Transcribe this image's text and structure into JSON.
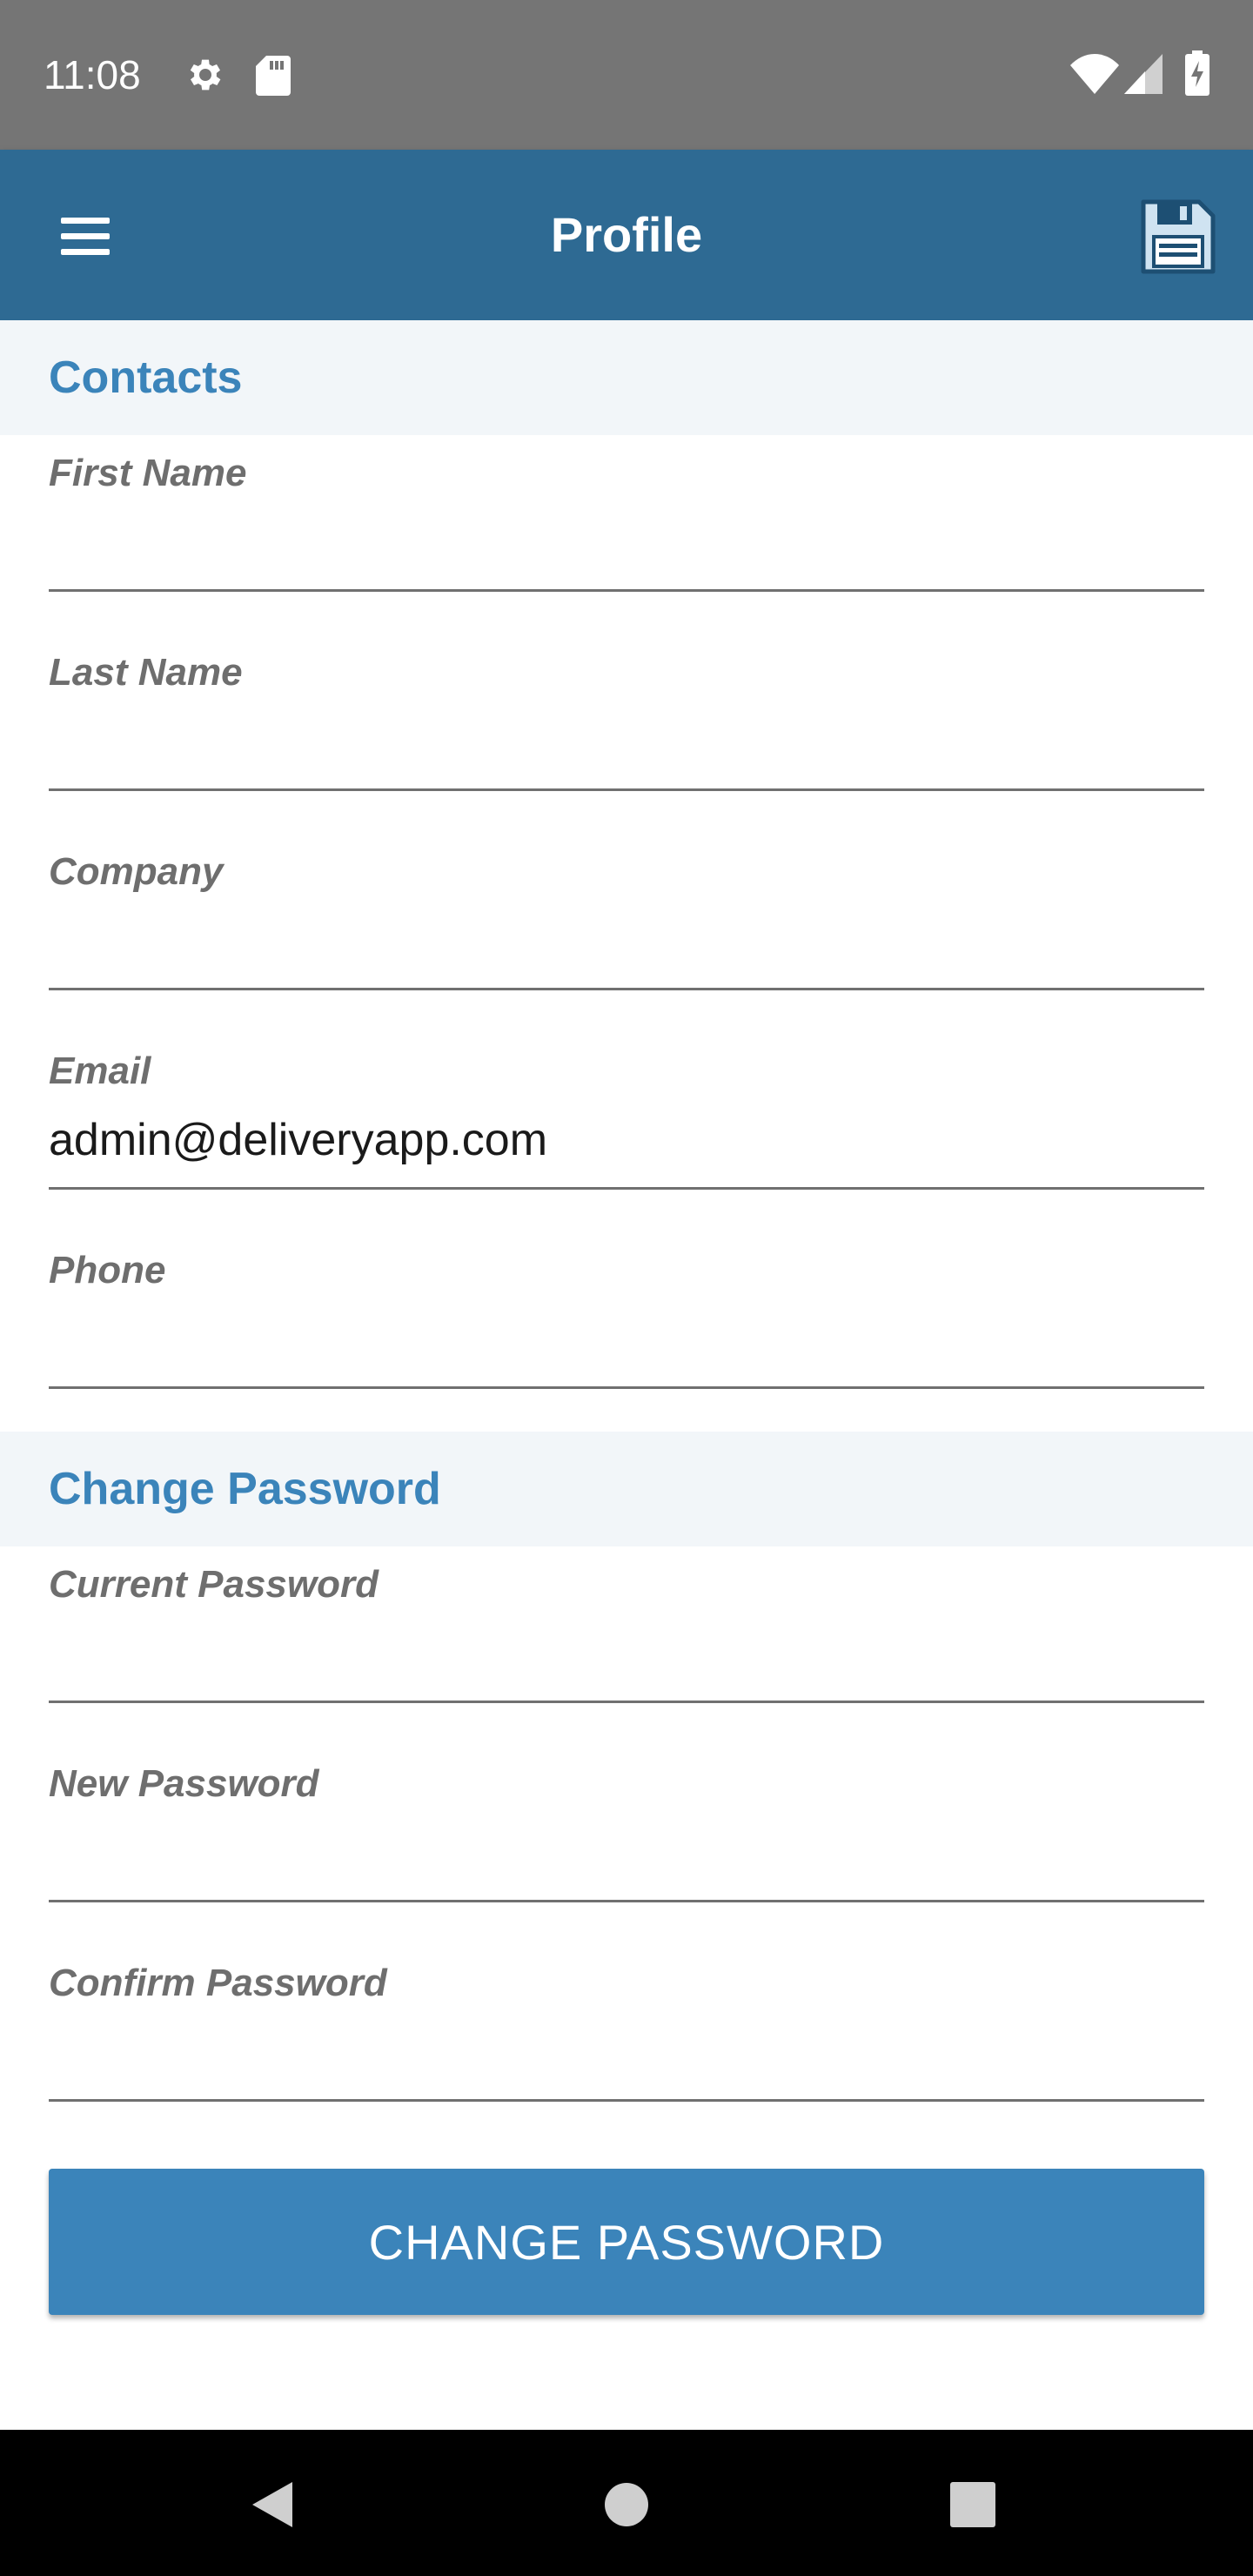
{
  "status_bar": {
    "time": "11:08",
    "icons": [
      "gear-icon",
      "sd-card-icon",
      "wifi-icon",
      "signal-icon",
      "battery-charging-icon"
    ]
  },
  "app_bar": {
    "title": "Profile",
    "menu_icon": "hamburger-menu-icon",
    "save_icon": "floppy-disk-save-icon"
  },
  "contacts": {
    "section_title": "Contacts",
    "fields": [
      {
        "label": "First Name",
        "value": ""
      },
      {
        "label": "Last Name",
        "value": ""
      },
      {
        "label": "Company",
        "value": ""
      },
      {
        "label": "Email",
        "value": "admin@deliveryapp.com"
      },
      {
        "label": "Phone",
        "value": ""
      }
    ]
  },
  "change_password": {
    "section_title": "Change Password",
    "fields": [
      {
        "label": "Current Password",
        "value": ""
      },
      {
        "label": "New Password",
        "value": ""
      },
      {
        "label": "Confirm Password",
        "value": ""
      }
    ],
    "button_label": "CHANGE PASSWORD"
  },
  "nav_bar": {
    "icons": [
      "back-triangle-icon",
      "home-circle-icon",
      "recents-square-icon"
    ]
  },
  "colors": {
    "app_bar": "#2e6a93",
    "accent": "#3b84ba",
    "section_bg": "#f2f6f9",
    "status_bar": "#757575",
    "label": "#6e6e6e"
  }
}
